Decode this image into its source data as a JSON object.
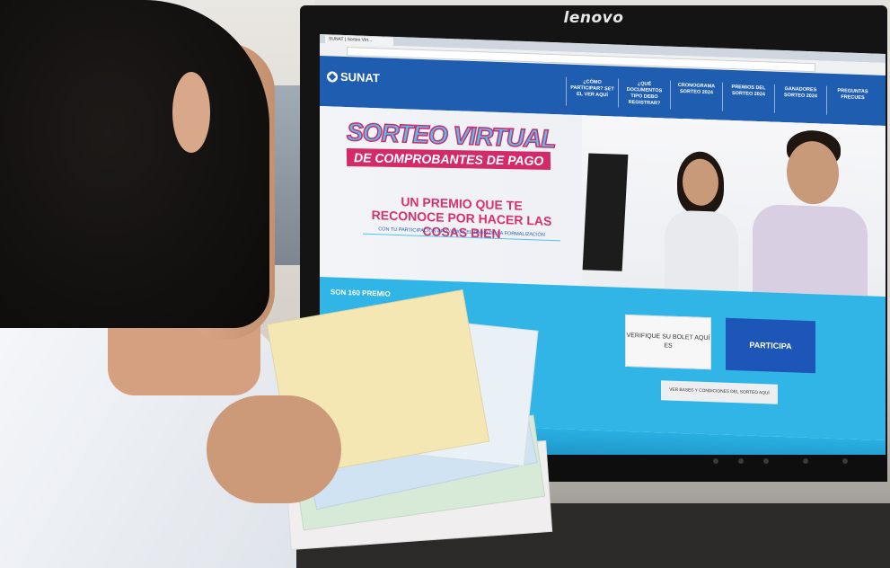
{
  "monitor": {
    "brand": "lenovo"
  },
  "browser": {
    "tab_title": "SUNAT | Sorteo Virt..."
  },
  "site": {
    "logo_text": "SUNAT",
    "nav": [
      {
        "label": "¿CÓMO PARTICIPAR? SET EL VER AQUÍ"
      },
      {
        "label": "¿QUÉ DOCUMENTOS TIPO DEBO REGISTRAR?"
      },
      {
        "label": "CRONOGRAMA SORTEO 2024"
      },
      {
        "label": "PREMIOS DEL SORTEO 2024"
      },
      {
        "label": "GANADORES SORTEO 2024"
      },
      {
        "label": "PREGUNTAS FRECUES"
      }
    ],
    "hero": {
      "title_line1": "SORTEO VIRTUAL",
      "title_line2": "DE COMPROBANTES DE PAGO",
      "tagline": "UN PREMIO QUE TE RECONOCE POR HACER LAS COSAS BIEN",
      "subtagline": "CON TU PARTICIPACIÓN APOYAMOS EL PAGO DE LA FORMALIZACIÓN"
    },
    "band": {
      "title": "SON 160 PREMIO",
      "verify_button": "VERIFIQUE SU BOLET AQUÍ ES",
      "participate_button": "PARTICIPA",
      "bases_button": "VER BASES Y CONDICIONES DEL SORTEO AQUÍ"
    }
  }
}
